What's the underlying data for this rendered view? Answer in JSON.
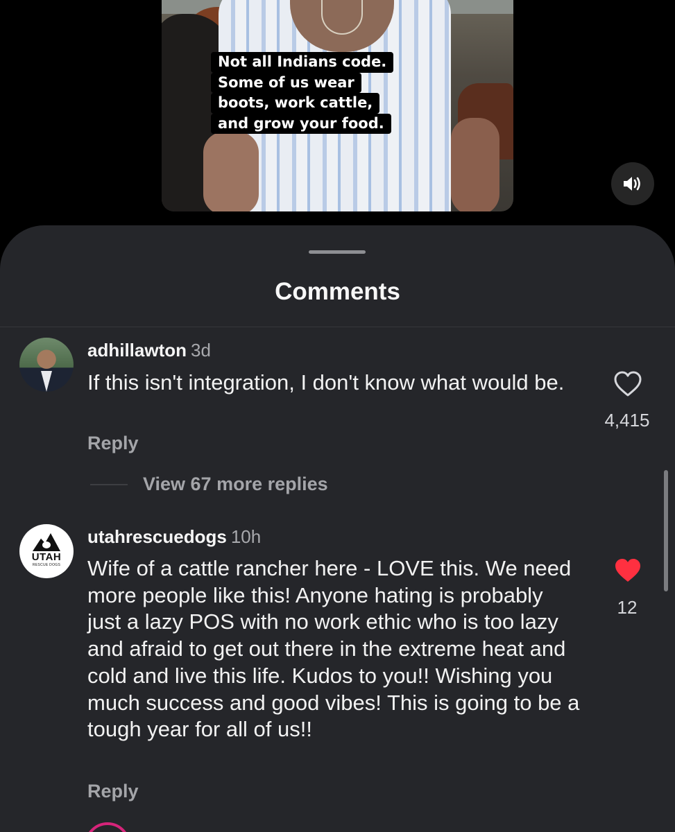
{
  "video": {
    "caption_lines": [
      "Not all Indians code.",
      "Some of us wear",
      "boots, work cattle,",
      "and grow your food."
    ],
    "mute_icon": "speaker-icon"
  },
  "sheet": {
    "title": "Comments"
  },
  "comments": [
    {
      "username": "adhillawton",
      "time": "3d",
      "text": "If this isn't integration, I don't know what would be.",
      "reply_label": "Reply",
      "like_count": "4,415",
      "liked": false,
      "view_more": "View 67 more replies"
    },
    {
      "username": "utahrescuedogs",
      "time": "10h",
      "text": "Wife of a cattle rancher here - LOVE this. We need more people like this! Anyone hating is probably just a lazy POS with no work ethic who is too lazy and afraid to get out there in the extreme heat and cold and live this life. Kudos to you!! Wishing you much success and good vibes! This is going to be a tough year for all of us!!",
      "reply_label": "Reply",
      "like_count": "12",
      "liked": true,
      "avatar_word": "UTAH",
      "avatar_sub": "RESCUE DOGS"
    }
  ],
  "colors": {
    "sheet_bg": "#25262a",
    "liked_heart": "#ff3040",
    "secondary_text": "#a4a5a9"
  }
}
